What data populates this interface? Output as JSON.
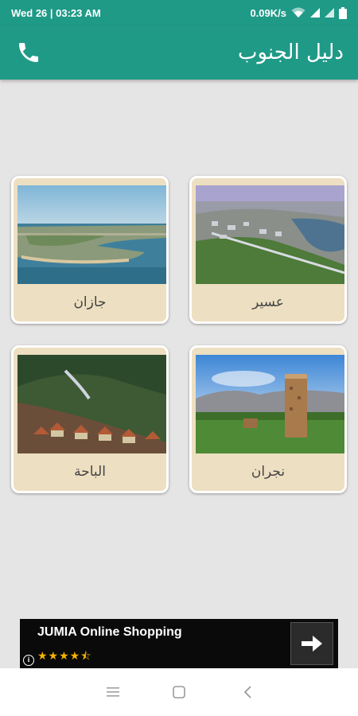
{
  "status_bar": {
    "time": "Wed 26 | 03:23 AM",
    "speed": "0.09K/s"
  },
  "app_bar": {
    "title": "دليل الجنوب",
    "phone_icon": "phone-icon"
  },
  "regions": [
    {
      "label": "جازان"
    },
    {
      "label": "عسير"
    },
    {
      "label": "الباحة"
    },
    {
      "label": "نجران"
    }
  ],
  "ad": {
    "title": "JUMIA Online Shopping",
    "stars": "★★★★⯪",
    "info": "i",
    "arrow_icon": "arrow-right-icon"
  },
  "colors": {
    "primary": "#1f9a87",
    "card": "#eddfc1",
    "background": "#e5e5e5"
  }
}
